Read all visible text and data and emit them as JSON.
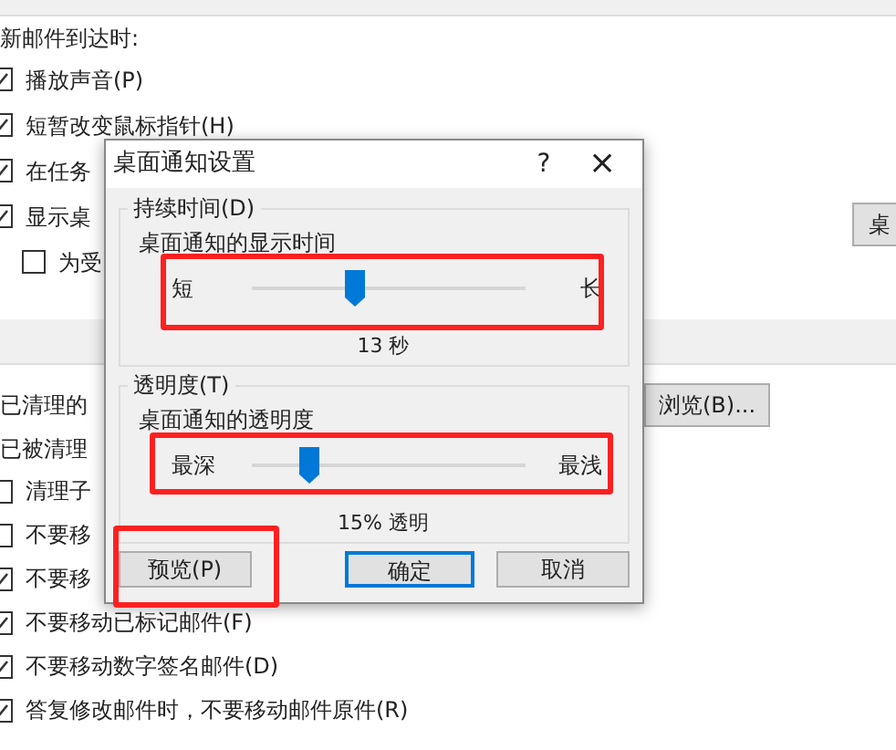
{
  "background": {
    "heading": "新邮件到达时:",
    "arrival_options": [
      {
        "label": "播放声音(P)",
        "checked": true
      },
      {
        "label": "短暂改变鼠标指针(H)",
        "checked": true
      },
      {
        "label": "在任务",
        "checked": true
      },
      {
        "label": "显示桌",
        "checked": true,
        "children": [
          {
            "label": "为受",
            "checked": false
          }
        ]
      }
    ],
    "side_button": "桌",
    "cleanup_label": "已清理的",
    "browse_button": "浏览(B)...",
    "moved_label": "已被清理",
    "cleanup_options": [
      {
        "label": "清理子",
        "checked": false
      },
      {
        "label": "不要移",
        "checked": false
      },
      {
        "label": "不要移",
        "checked": true
      },
      {
        "label": "不要移动已标记邮件(F)",
        "checked": true
      },
      {
        "label": "不要移动数字签名邮件(D)",
        "checked": true
      },
      {
        "label": "答复修改邮件时，不要移动邮件原件(R)",
        "checked": true
      }
    ]
  },
  "dialog": {
    "title": "桌面通知设置",
    "help": "?",
    "close": "×",
    "groups": [
      {
        "legend": "持续时间(D)",
        "label": "桌面通知的显示时间",
        "min_label": "短",
        "max_label": "长",
        "level": 0.37,
        "reading": "13 秒"
      },
      {
        "legend": "透明度(T)",
        "label": "桌面通知的透明度",
        "min_label": "最深",
        "max_label": "最浅",
        "level": 0.21,
        "reading": "15% 透明"
      }
    ],
    "buttons": [
      {
        "label": "预览(P)",
        "default": false
      },
      {
        "label": "确定",
        "default": true
      },
      {
        "label": "取消",
        "default": false
      }
    ]
  }
}
